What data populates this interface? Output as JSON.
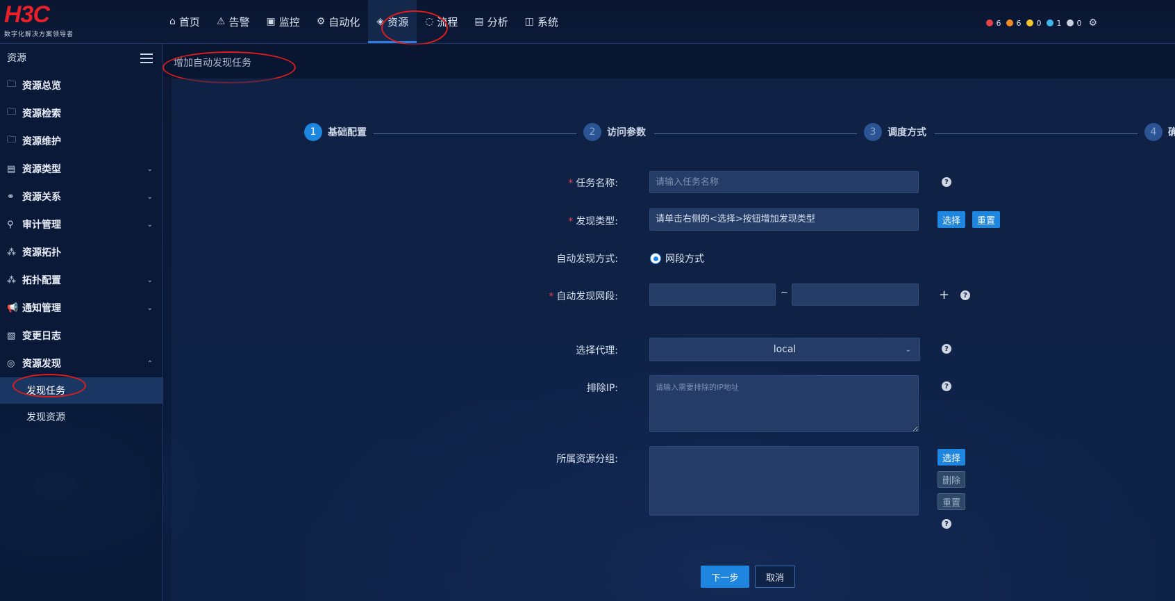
{
  "logo": {
    "text": "H3C",
    "tagline": "数字化解决方案领导者"
  },
  "nav": [
    {
      "icon": "home-icon",
      "glyph": "⌂",
      "label": "首页"
    },
    {
      "icon": "warning-icon",
      "glyph": "⚠",
      "label": "告警"
    },
    {
      "icon": "monitor-icon",
      "glyph": "▣",
      "label": "监控"
    },
    {
      "icon": "automation-icon",
      "glyph": "⚙",
      "label": "自动化"
    },
    {
      "icon": "resource-icon",
      "glyph": "◈",
      "label": "资源"
    },
    {
      "icon": "flow-icon",
      "glyph": "◌",
      "label": "流程"
    },
    {
      "icon": "analysis-icon",
      "glyph": "▤",
      "label": "分析"
    },
    {
      "icon": "system-icon",
      "glyph": "◫",
      "label": "系统"
    }
  ],
  "alerts": [
    {
      "color": "#e5414b",
      "count": "6"
    },
    {
      "color": "#f08a24",
      "count": "6"
    },
    {
      "color": "#f3c52d",
      "count": "0"
    },
    {
      "color": "#3fb6e8",
      "count": "1"
    },
    {
      "color": "#c9d1de",
      "count": "0"
    }
  ],
  "sidebar": {
    "title": "资源",
    "items": [
      {
        "icon": "folder-search-icon",
        "glyph": "🗀",
        "label": "资源总览",
        "chevron": ""
      },
      {
        "icon": "folder-search-icon",
        "glyph": "🗀",
        "label": "资源检索",
        "chevron": ""
      },
      {
        "icon": "folder-search-icon",
        "glyph": "🗀",
        "label": "资源维护",
        "chevron": ""
      },
      {
        "icon": "document-icon",
        "glyph": "▤",
        "label": "资源类型",
        "chevron": "⌄"
      },
      {
        "icon": "relation-icon",
        "glyph": "⚭",
        "label": "资源关系",
        "chevron": "⌄"
      },
      {
        "icon": "audit-icon",
        "glyph": "⚲",
        "label": "审计管理",
        "chevron": "⌄"
      },
      {
        "icon": "topology-icon",
        "glyph": "⁂",
        "label": "资源拓扑",
        "chevron": ""
      },
      {
        "icon": "topology-config-icon",
        "glyph": "⁂",
        "label": "拓扑配置",
        "chevron": "⌄"
      },
      {
        "icon": "megaphone-icon",
        "glyph": "📢",
        "label": "通知管理",
        "chevron": "⌄"
      },
      {
        "icon": "log-icon",
        "glyph": "▧",
        "label": "变更日志",
        "chevron": ""
      },
      {
        "icon": "compass-icon",
        "glyph": "◎",
        "label": "资源发现",
        "chevron": "⌃"
      }
    ],
    "subitems": [
      {
        "label": "发现任务",
        "active": true
      },
      {
        "label": "发现资源",
        "active": false
      }
    ]
  },
  "breadcrumb": "增加自动发现任务",
  "steps": [
    {
      "num": "1",
      "label": "基础配置"
    },
    {
      "num": "2",
      "label": "访问参数"
    },
    {
      "num": "3",
      "label": "调度方式"
    },
    {
      "num": "4",
      "label": "确"
    }
  ],
  "form": {
    "task_name": {
      "label": "任务名称:",
      "required": "*",
      "placeholder": "请输入任务名称",
      "help": "?"
    },
    "discover_type": {
      "label": "发现类型:",
      "required": "*",
      "value": "请单击右侧的<选择>按钮增加发现类型",
      "select_btn": "选择",
      "reset_btn": "重置"
    },
    "discover_mode": {
      "label": "自动发现方式:",
      "option": "网段方式"
    },
    "segment": {
      "label": "自动发现网段:",
      "required": "*",
      "separator": "~",
      "add": "+",
      "help": "?"
    },
    "proxy": {
      "label": "选择代理:",
      "value": "local",
      "help": "?"
    },
    "exclude_ip": {
      "label": "排除IP:",
      "placeholder": "请输入需要排除的IP地址",
      "help": "?"
    },
    "group": {
      "label": "所属资源分组:",
      "select_btn": "选择",
      "delete_btn": "删除",
      "reset_btn": "重置",
      "help": "?"
    }
  },
  "actions": {
    "next": "下一步",
    "cancel": "取消"
  }
}
